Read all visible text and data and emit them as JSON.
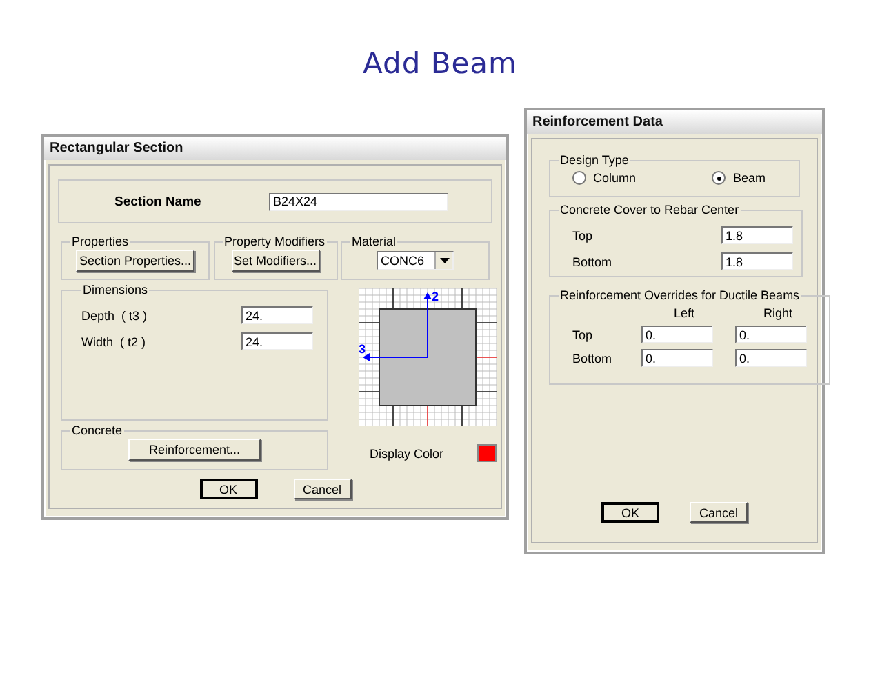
{
  "title": "Add Beam",
  "rectangular_section": {
    "title": "Rectangular Section",
    "section_name": {
      "label": "Section Name",
      "value": "B24X24"
    },
    "properties": {
      "legend": "Properties",
      "button": "Section Properties..."
    },
    "property_modifiers": {
      "legend": "Property Modifiers",
      "button": "Set Modifiers..."
    },
    "material": {
      "legend": "Material",
      "value": "CONC6"
    },
    "dimensions": {
      "legend": "Dimensions",
      "fields": [
        {
          "label": "Depth  ( t3 )",
          "value": "24."
        },
        {
          "label": "Width  ( t2 )",
          "value": "24."
        }
      ]
    },
    "concrete": {
      "legend": "Concrete",
      "button": "Reinforcement..."
    },
    "preview": {
      "axis_labels": [
        "2",
        "3"
      ]
    },
    "display_color": {
      "label": "Display Color",
      "color": "#ff0000"
    },
    "buttons": [
      {
        "label": "OK",
        "default": true
      },
      {
        "label": "Cancel",
        "default": false
      }
    ]
  },
  "reinforcement_data": {
    "title": "Reinforcement Data",
    "design_type": {
      "legend": "Design Type",
      "options": [
        {
          "label": "Column",
          "selected": false
        },
        {
          "label": "Beam",
          "selected": true
        }
      ]
    },
    "cover": {
      "legend": "Concrete Cover to Rebar Center",
      "fields": [
        {
          "label": "Top",
          "value": "1.8"
        },
        {
          "label": "Bottom",
          "value": "1.8"
        }
      ]
    },
    "overrides": {
      "legend": "Reinforcement Overrides for Ductile Beams",
      "columns": [
        "Left",
        "Right"
      ],
      "rows": [
        {
          "label": "Top",
          "values": [
            "0.",
            "0."
          ]
        },
        {
          "label": "Bottom",
          "values": [
            "0.",
            "0."
          ]
        }
      ]
    },
    "buttons": [
      {
        "label": "OK",
        "default": true
      },
      {
        "label": "Cancel",
        "default": false
      }
    ]
  }
}
